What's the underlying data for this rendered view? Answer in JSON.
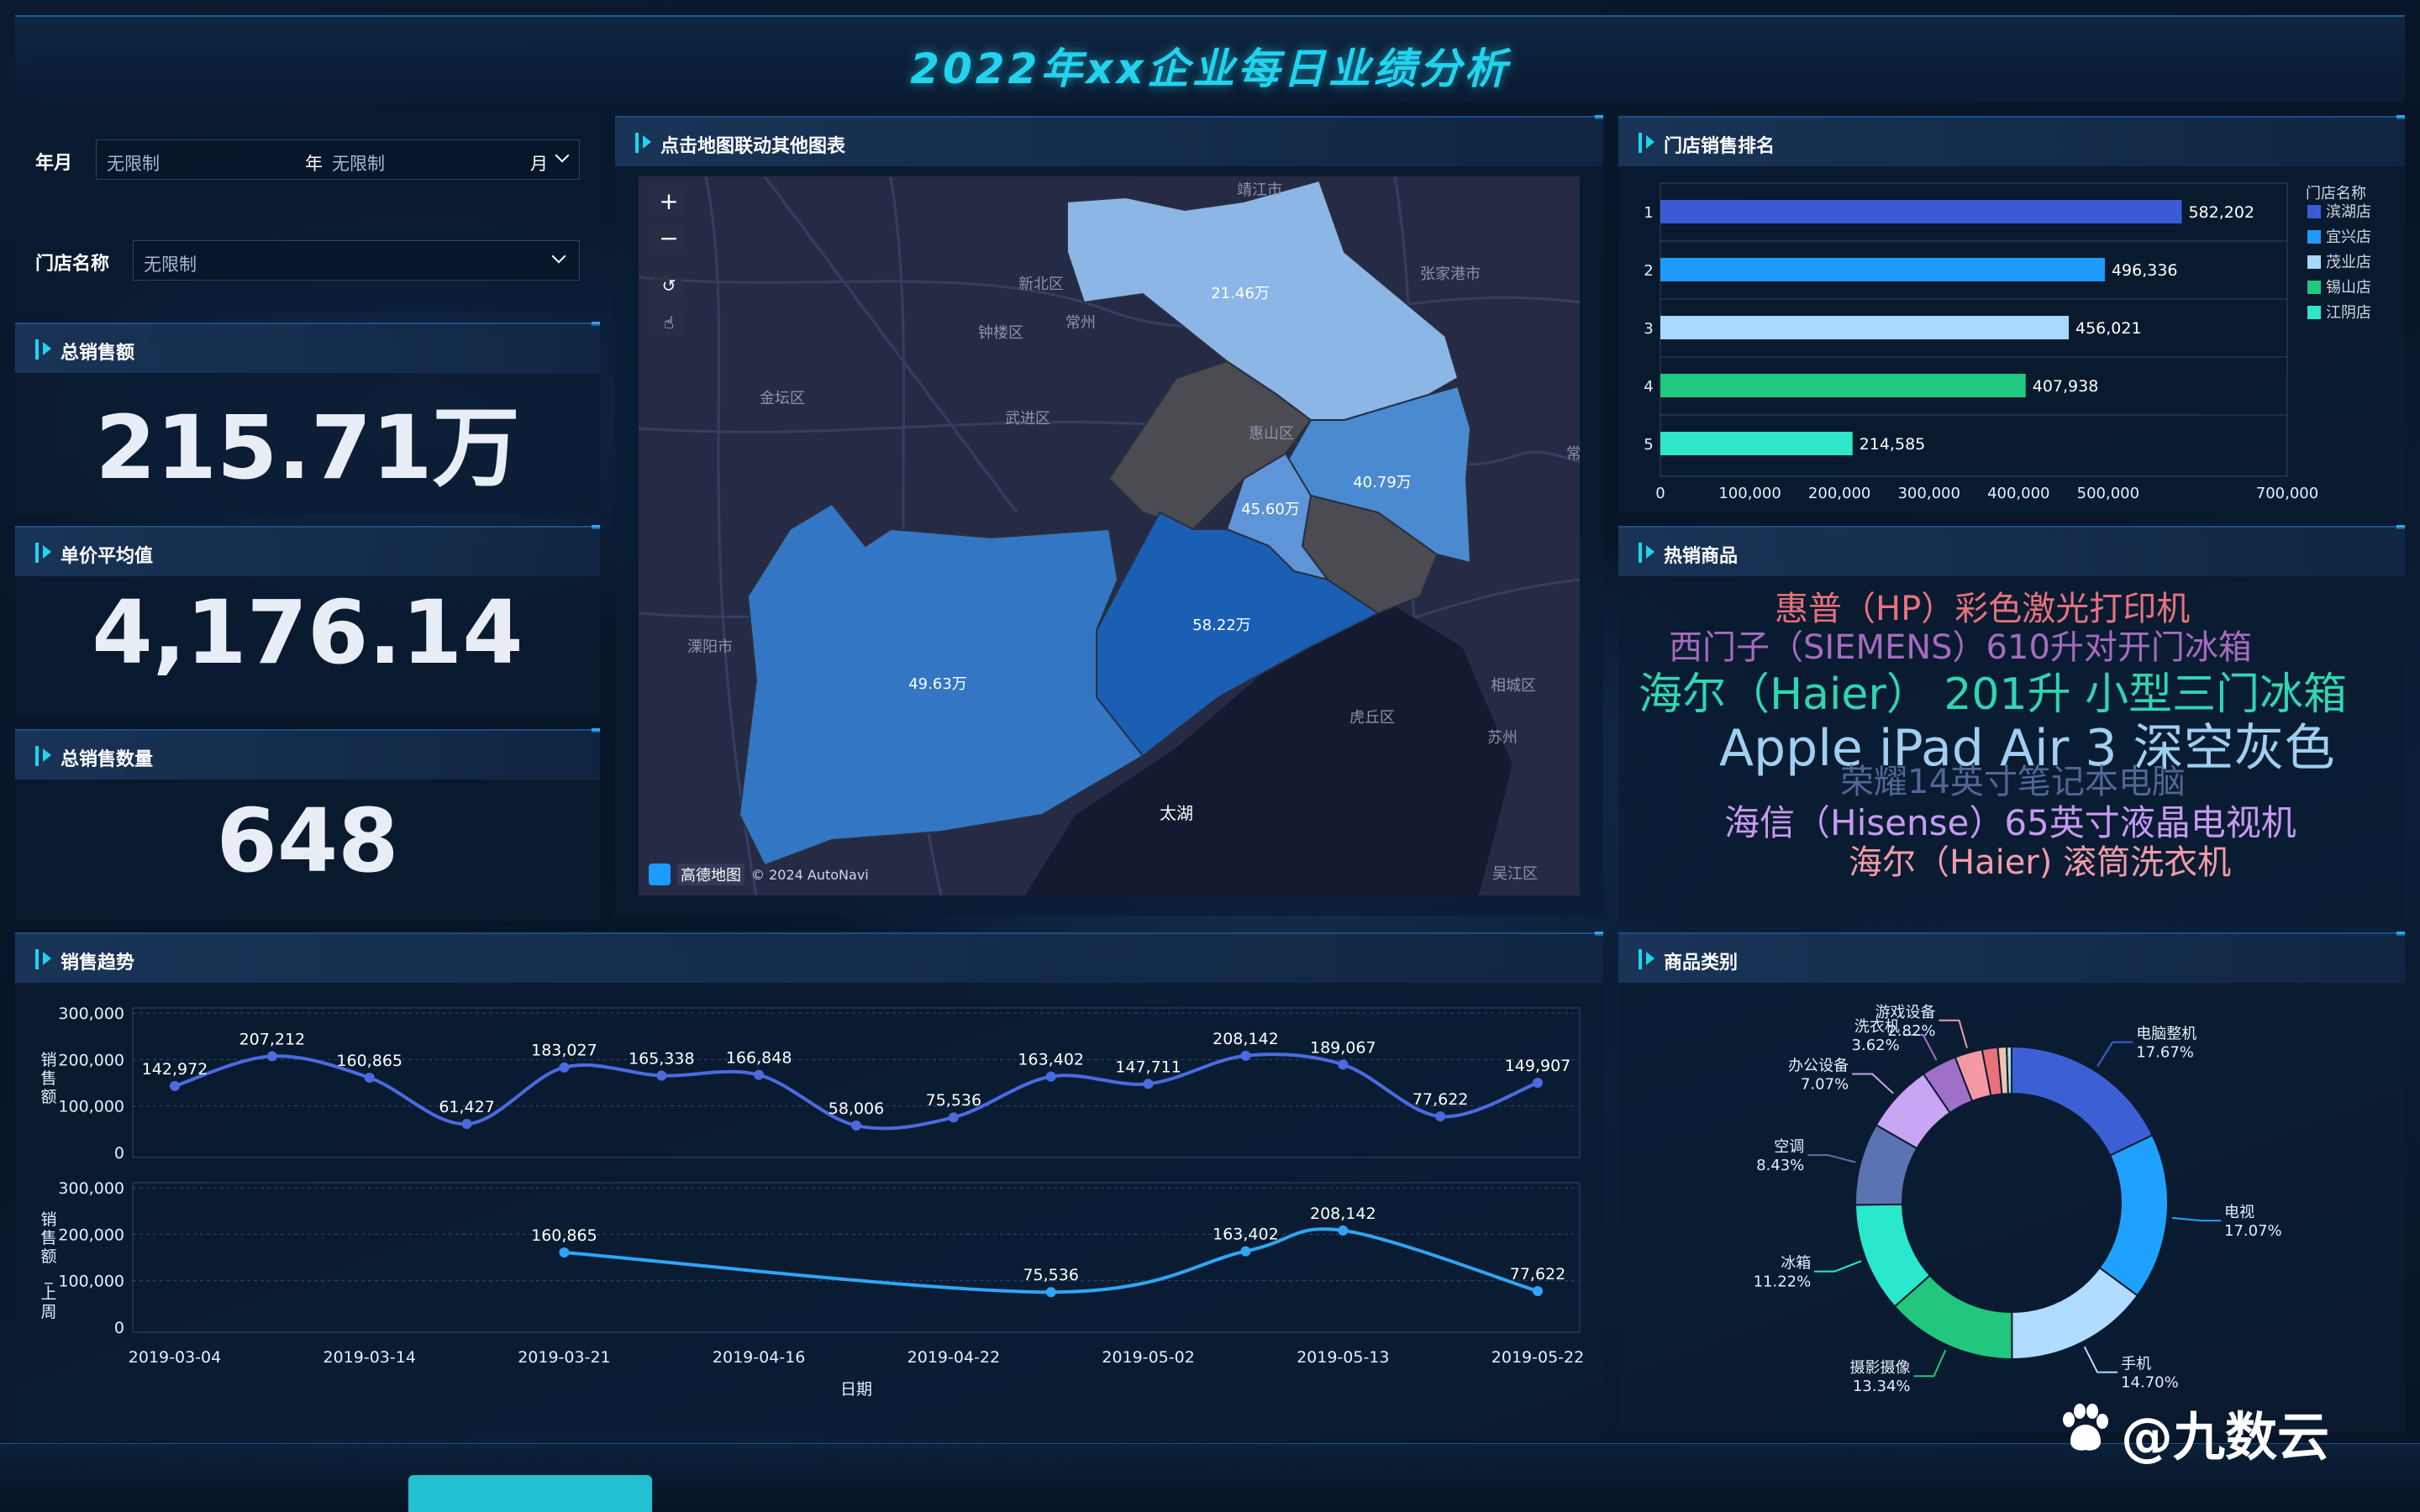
{
  "header": {
    "title": "2022年xx企业每日业绩分析"
  },
  "filters": {
    "year_month_label": "年月",
    "year_value": "无限制",
    "year_unit": "年",
    "month_value": "无限制",
    "month_unit": "月",
    "store_label": "门店名称",
    "store_value": "无限制"
  },
  "kpis": {
    "total_sales": {
      "title": "总销售额",
      "value": "215.71万"
    },
    "avg_price": {
      "title": "单价平均值",
      "value": "4,176.14"
    },
    "total_qty": {
      "title": "总销售数量",
      "value": "648"
    }
  },
  "map": {
    "title": "点击地图联动其他图表",
    "regions": [
      "21.46万",
      "40.79万",
      "45.60万",
      "58.22万",
      "49.63万"
    ],
    "places": [
      "靖江市",
      "新北区",
      "常州",
      "张家港市",
      "钟楼区",
      "金坛区",
      "武进区",
      "惠山区",
      "溧阳市",
      "相城区",
      "虎丘区",
      "苏州",
      "太湖",
      "吴江区",
      "常"
    ],
    "attribution": "高德地图",
    "copyright": "© 2024 AutoNavi",
    "controls": [
      "+",
      "−",
      "↺",
      "☝"
    ]
  },
  "ranking": {
    "title": "门店销售排名",
    "legend_title": "门店名称",
    "ranks": [
      "1",
      "2",
      "3",
      "4",
      "5"
    ],
    "x_ticks": [
      "0",
      "100,000",
      "200,000",
      "300,000",
      "400,000",
      "500,000",
      "700,000"
    ]
  },
  "hot_products": {
    "title": "热销商品",
    "words": [
      {
        "text": "惠普（HP）彩色激光打印机",
        "color": "#e8727c"
      },
      {
        "text": "西门子（SIEMENS）610升对开门冰箱",
        "color": "#a66bbf"
      },
      {
        "text": "海尔（Haier） 201升 小型三门冰箱",
        "color": "#2fd6b0"
      },
      {
        "text": "Apple iPad Air 3 深空灰色",
        "color": "#9fd0f2"
      },
      {
        "text": "荣耀14英寸笔记本电脑",
        "color": "#4f6796"
      },
      {
        "text": "海信（Hisense）65英寸液晶电视机",
        "color": "#c69af0"
      },
      {
        "text": "海尔（Haier) 滚筒洗衣机",
        "color": "#f29ca8"
      }
    ]
  },
  "trend": {
    "title": "销售趋势",
    "y1_label": "销售额",
    "y2_label": "销售额_上周",
    "x_label": "日期",
    "y_ticks": [
      "300,000",
      "200,000",
      "100,000",
      "0"
    ]
  },
  "category": {
    "title": "商品类别"
  },
  "watermark": {
    "text": "@九数云"
  },
  "chart_data": [
    {
      "type": "bar",
      "title": "门店销售排名",
      "legend": "门店名称",
      "categories": [
        "滨湖店",
        "宜兴店",
        "茂业店",
        "锡山店",
        "江阴店"
      ],
      "values": [
        582202,
        496336,
        456021,
        407938,
        214585
      ],
      "value_labels": [
        "582,202",
        "496,336",
        "456,021",
        "407,938",
        "214,585"
      ],
      "colors": [
        "#3b5bd6",
        "#1e9bff",
        "#a8d8ff",
        "#21c97f",
        "#2fe6c7"
      ],
      "xlim": [
        0,
        700000
      ],
      "orientation": "horizontal"
    },
    {
      "type": "line",
      "title": "销售趋势",
      "xlabel": "日期",
      "x_ticks": [
        "2019-03-04",
        "2019-03-14",
        "2019-03-21",
        "2019-04-16",
        "2019-04-22",
        "2019-05-02",
        "2019-05-13",
        "2019-05-22"
      ],
      "series": [
        {
          "name": "销售额",
          "values": [
            142972,
            207212,
            160865,
            61427,
            183027,
            165338,
            166848,
            58006,
            75536,
            163402,
            147711,
            208142,
            189067,
            77622,
            149907
          ],
          "labels": [
            "142,972",
            "207,212",
            "160,865",
            "61,427",
            "183,027",
            "165,338",
            "166,848",
            "58,006",
            "75,536",
            "163,402",
            "147,711",
            "208,142",
            "189,067",
            "77,622",
            "149,907"
          ],
          "color": "#4a6be0"
        },
        {
          "name": "销售额_上周",
          "points": [
            [
              4,
              160865
            ],
            [
              9,
              75536
            ],
            [
              11,
              163402
            ],
            [
              12,
              208142
            ],
            [
              14,
              77622
            ]
          ],
          "labels": [
            "160,865",
            "75,536",
            "163,402",
            "208,142",
            "77,622"
          ],
          "color": "#2ea6f5"
        }
      ],
      "ylim": [
        0,
        300000
      ]
    },
    {
      "type": "pie",
      "title": "商品类别",
      "slices": [
        {
          "name": "电脑整机",
          "value": 17.67,
          "label": "17.67%",
          "color": "#3d5fd6"
        },
        {
          "name": "电视",
          "value": 17.07,
          "label": "17.07%",
          "color": "#1fa2ff"
        },
        {
          "name": "手机",
          "value": 14.7,
          "label": "14.70%",
          "color": "#b0dcff"
        },
        {
          "name": "摄影摄像",
          "value": 13.34,
          "label": "13.34%",
          "color": "#21c77c"
        },
        {
          "name": "冰箱",
          "value": 11.22,
          "label": "11.22%",
          "color": "#2ae8cc"
        },
        {
          "name": "空调",
          "value": 8.43,
          "label": "8.43%",
          "color": "#5b73b0"
        },
        {
          "name": "办公设备",
          "value": 7.07,
          "label": "7.07%",
          "color": "#c9a5f3"
        },
        {
          "name": "洗衣机",
          "value": 3.62,
          "label": "3.62%",
          "color": "#a070c9"
        },
        {
          "name": "游戏设备",
          "value": 2.82,
          "label": "2.82%",
          "color": "#f49aa6"
        },
        {
          "name": "",
          "value": 1.6,
          "label": "",
          "color": "#e8727c"
        },
        {
          "name": "",
          "value": 0.9,
          "label": "",
          "color": "#f2c2b0"
        },
        {
          "name": "",
          "value": 0.5,
          "label": "",
          "color": "#9fe0e0"
        }
      ]
    }
  ]
}
